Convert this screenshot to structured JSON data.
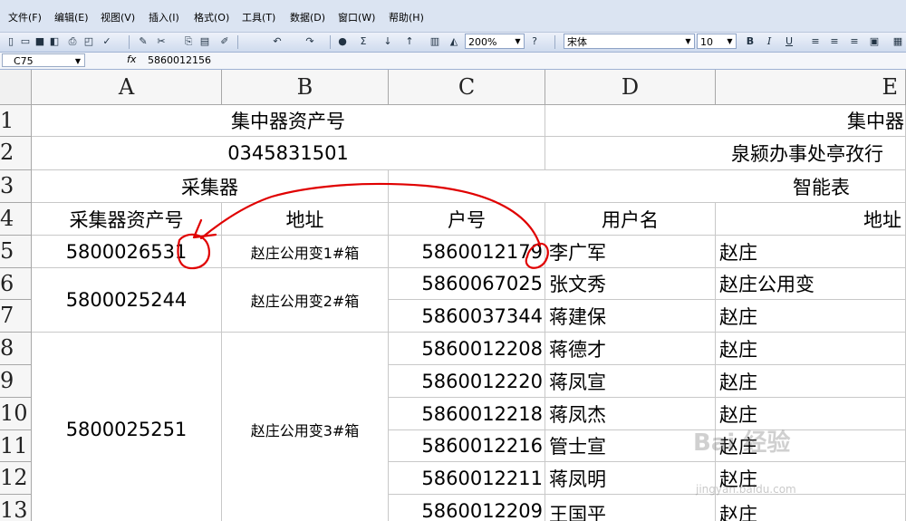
{
  "menu": [
    "文件(F)",
    "编辑(E)",
    "视图(V)",
    "插入(I)",
    "格式(O)",
    "工具(T)",
    "数据(D)",
    "窗口(W)",
    "帮助(H)"
  ],
  "toolbar": {
    "zoom": "200%",
    "font": "宋体",
    "font_size": "10",
    "bold": "B",
    "italic": "I",
    "underline": "U",
    "sum": "Σ"
  },
  "formula_bar": {
    "name_box": "C75",
    "fx": "fx",
    "content": "5860012156"
  },
  "columns": [
    "A",
    "B",
    "C",
    "D",
    "E"
  ],
  "rows": [
    "1",
    "2",
    "3",
    "4",
    "5",
    "6",
    "7",
    "8",
    "9",
    "10",
    "11",
    "12",
    "13"
  ],
  "sheet": {
    "r1_left": "集中器资产号",
    "r1_right": "集中器",
    "r2_left": "0345831501",
    "r2_right": "泉颍办事处亭孜行",
    "r3_left": "采集器",
    "r3_right": "智能表",
    "hdr_a": "采集器资产号",
    "hdr_b": "地址",
    "hdr_c": "户号",
    "hdr_d": "用户名",
    "hdr_e": "地址",
    "groups": [
      {
        "a": "5800026531",
        "b": "赵庄公用变1#箱"
      },
      {
        "a": "5800025244",
        "b": "赵庄公用变2#箱"
      },
      {
        "a": "5800025251",
        "b": "赵庄公用变3#箱"
      }
    ],
    "meters": [
      {
        "c": "5860012179",
        "d": "李广军",
        "e": "赵庄"
      },
      {
        "c": "5860067025",
        "d": "张文秀",
        "e": "赵庄公用变"
      },
      {
        "c": "5860037344",
        "d": "蒋建保",
        "e": "赵庄"
      },
      {
        "c": "5860012208",
        "d": "蒋德才",
        "e": "赵庄"
      },
      {
        "c": "5860012220",
        "d": "蒋凤宣",
        "e": "赵庄"
      },
      {
        "c": "5860012218",
        "d": "蒋凤杰",
        "e": "赵庄"
      },
      {
        "c": "5860012216",
        "d": "管士宣",
        "e": "赵庄"
      },
      {
        "c": "5860012211",
        "d": "蒋凤明",
        "e": "赵庄"
      },
      {
        "c": "5860012209",
        "d": "王国平",
        "e": "赵庄"
      }
    ]
  },
  "watermark": {
    "main": "Bai 经验",
    "sub": "jingyan.baidu.com"
  },
  "annotation_color": "#e00000"
}
